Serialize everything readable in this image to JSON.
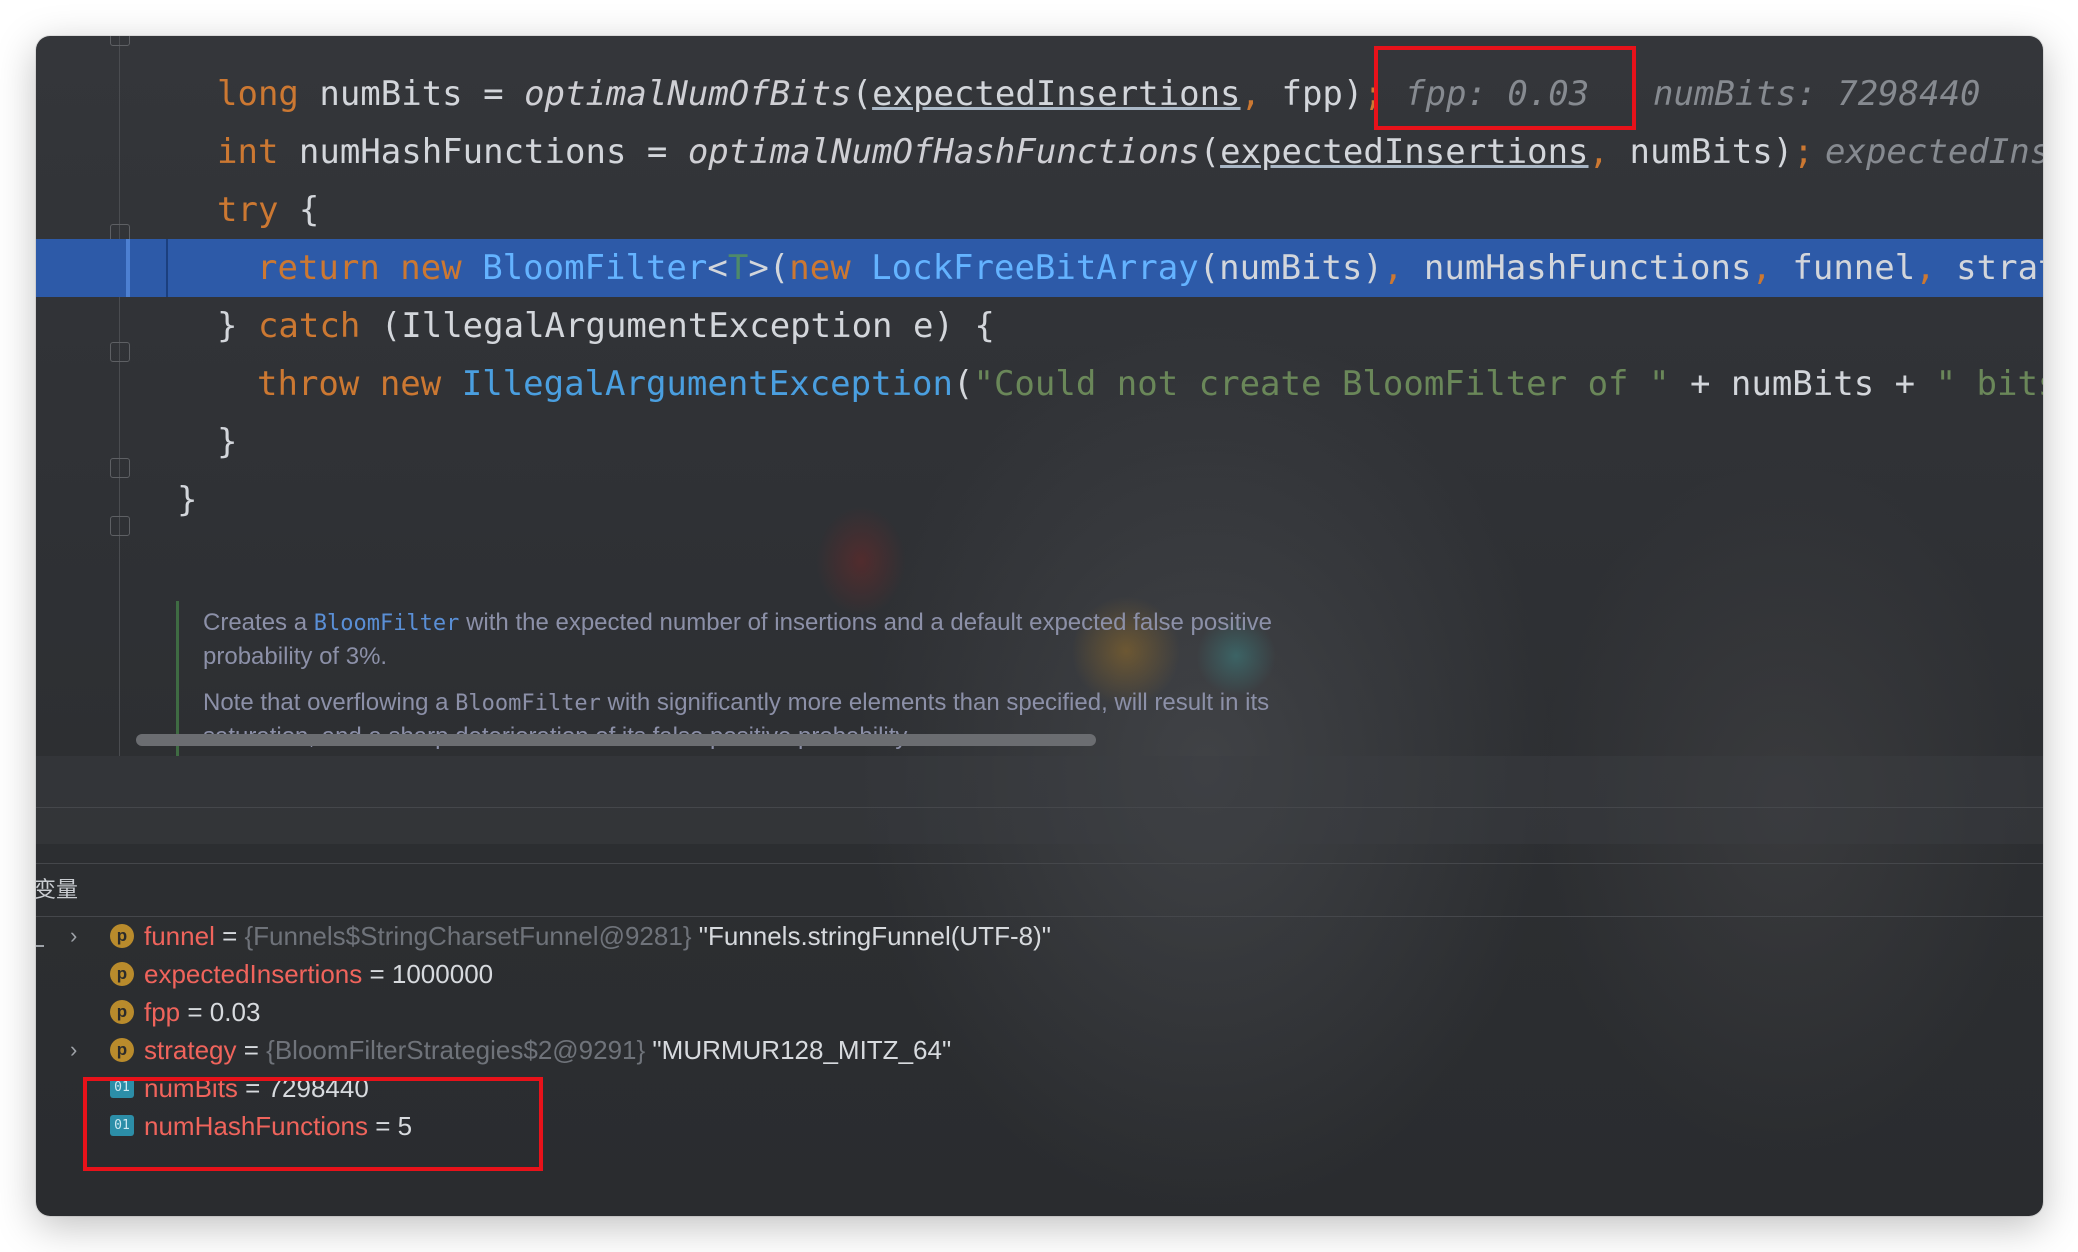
{
  "editor": {
    "line_prev_fragment": "}",
    "line1": {
      "kw": "long",
      "lhs": " numBits = ",
      "fn": "optimalNumOfBits",
      "open": "(",
      "arg1": "expectedInsertions",
      "comma": ",",
      "rest": " fpp)",
      "semi": ";",
      "hint1": "fpp: 0.03",
      "hint2": "numBits: 7298440"
    },
    "line2": {
      "kw": "int",
      "lhs": " numHashFunctions = ",
      "fn": "optimalNumOfHashFunctions",
      "open": "(",
      "arg1": "expectedInsertions",
      "comma": ",",
      "rest": " numBits)",
      "semi": ";",
      "hint": "expectedIns"
    },
    "line3": {
      "kw": "try",
      "rest": " {"
    },
    "line4": {
      "kw1": "return",
      "kw2": " new",
      "cls1": " BloomFilter",
      "lt": "<",
      "tparam": "T",
      "gt": ">(",
      "kw3": "new",
      "cls2": " LockFreeBitArray",
      "rest1": "(numBits)",
      "c1": ",",
      "rest2": " numHashFunctions",
      "c2": ",",
      "rest3": " funnel",
      "c3": ",",
      "rest4": " strateg"
    },
    "line5": {
      "brace": "} ",
      "kw": "catch",
      "rest": " (IllegalArgumentException e) {"
    },
    "line6": {
      "kw1": "throw",
      "kw2": " new",
      "cls": " IllegalArgumentException",
      "open": "(",
      "str1": "\"Could not create BloomFilter of \"",
      "mid": " + numBits + ",
      "str2": "\" bits\"",
      "tail": ")"
    },
    "line7": {
      "text": "}"
    },
    "line8": {
      "text": "}"
    }
  },
  "doc": {
    "p1_a": "Creates a ",
    "p1_link": "BloomFilter",
    "p1_b": " with the expected number of insertions and a default expected false positive",
    "p1_c": "probability of 3%.",
    "p2_a": "Note that overflowing a ",
    "p2_code": "BloomFilter",
    "p2_b": " with significantly more elements than specified, will result in its",
    "p2_c": "saturation, and a sharp deterioration of its false positive probability."
  },
  "variables": {
    "title": "变量",
    "rows": [
      {
        "badge": "p",
        "name": "funnel",
        "eq": " = ",
        "type": "{Funnels$StringCharsetFunnel@9281}",
        "value": " \"Funnels.stringFunnel(UTF-8)\"",
        "expandable": true
      },
      {
        "badge": "p",
        "name": "expectedInsertions",
        "eq": " = ",
        "type": "",
        "value": "1000000",
        "expandable": false
      },
      {
        "badge": "p",
        "name": "fpp",
        "eq": " = ",
        "type": "",
        "value": "0.03",
        "expandable": false
      },
      {
        "badge": "p",
        "name": "strategy",
        "eq": " = ",
        "type": "{BloomFilterStrategies$2@9291}",
        "value": " \"MURMUR128_MITZ_64\"",
        "expandable": true
      },
      {
        "badge": "01",
        "name": "numBits",
        "eq": " = ",
        "type": "",
        "value": "7298440",
        "expandable": false
      },
      {
        "badge": "01",
        "name": "numHashFunctions",
        "eq": " = ",
        "type": "",
        "value": "5",
        "expandable": false
      }
    ]
  },
  "colors": {
    "keyword": "#cc7832",
    "class": "#4a9fe0",
    "string": "#6a8759",
    "highlight": "#2d5aa8",
    "annotation": "#e8121a",
    "var_name": "#f0645c"
  }
}
